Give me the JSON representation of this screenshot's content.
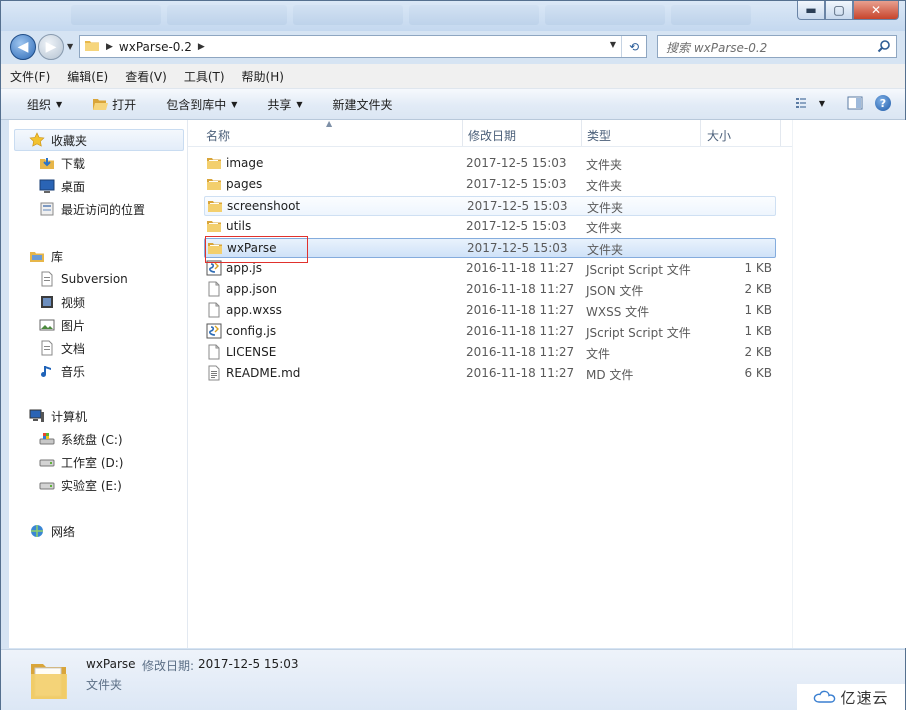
{
  "window": {
    "controls": {
      "minimize": "▬",
      "maximize": "▢",
      "close": "✕"
    }
  },
  "address": {
    "path": "wxParse-0.2",
    "search_placeholder": "搜索 wxParse-0.2"
  },
  "menu": [
    "文件(F)",
    "编辑(E)",
    "查看(V)",
    "工具(T)",
    "帮助(H)"
  ],
  "toolbar": {
    "organize": "组织",
    "open": "打开",
    "include_library": "包含到库中",
    "share": "共享",
    "new_folder": "新建文件夹",
    "help_icon": "?"
  },
  "nav": {
    "favorites": "收藏夹",
    "favorites_items": [
      "下载",
      "桌面",
      "最近访问的位置"
    ],
    "libraries": "库",
    "library_items": [
      "Subversion",
      "视频",
      "图片",
      "文档",
      "音乐"
    ],
    "computer": "计算机",
    "drives": [
      "系统盘 (C:)",
      "工作室 (D:)",
      "实验室 (E:)"
    ],
    "network": "网络"
  },
  "columns": {
    "name": "名称",
    "modified": "修改日期",
    "type": "类型",
    "size": "大小"
  },
  "files": [
    {
      "name": "image",
      "modified": "2017-12-5 15:03",
      "type": "文件夹",
      "size": "",
      "icon": "folder-icon"
    },
    {
      "name": "pages",
      "modified": "2017-12-5 15:03",
      "type": "文件夹",
      "size": "",
      "icon": "folder-icon"
    },
    {
      "name": "screenshoot",
      "modified": "2017-12-5 15:03",
      "type": "文件夹",
      "size": "",
      "icon": "folder-icon"
    },
    {
      "name": "utils",
      "modified": "2017-12-5 15:03",
      "type": "文件夹",
      "size": "",
      "icon": "folder-icon"
    },
    {
      "name": "wxParse",
      "modified": "2017-12-5 15:03",
      "type": "文件夹",
      "size": "",
      "icon": "folder-icon"
    },
    {
      "name": "app.js",
      "modified": "2016-11-18 11:27",
      "type": "JScript Script 文件",
      "size": "1 KB",
      "icon": "script-icon"
    },
    {
      "name": "app.json",
      "modified": "2016-11-18 11:27",
      "type": "JSON 文件",
      "size": "2 KB",
      "icon": "file-icon"
    },
    {
      "name": "app.wxss",
      "modified": "2016-11-18 11:27",
      "type": "WXSS 文件",
      "size": "1 KB",
      "icon": "file-icon"
    },
    {
      "name": "config.js",
      "modified": "2016-11-18 11:27",
      "type": "JScript Script 文件",
      "size": "1 KB",
      "icon": "script-icon"
    },
    {
      "name": "LICENSE",
      "modified": "2016-11-18 11:27",
      "type": "文件",
      "size": "2 KB",
      "icon": "file-icon"
    },
    {
      "name": "README.md",
      "modified": "2016-11-18 11:27",
      "type": "MD 文件",
      "size": "6 KB",
      "icon": "text-file-icon"
    }
  ],
  "details": {
    "name": "wxParse",
    "modified_label": "修改日期:",
    "modified": "2017-12-5 15:03",
    "type": "文件夹"
  },
  "watermark": "亿速云",
  "colors": {
    "selection": "#cfe2f8",
    "highlight_box": "#e0312d",
    "window_frame": "#d6e4f3"
  }
}
